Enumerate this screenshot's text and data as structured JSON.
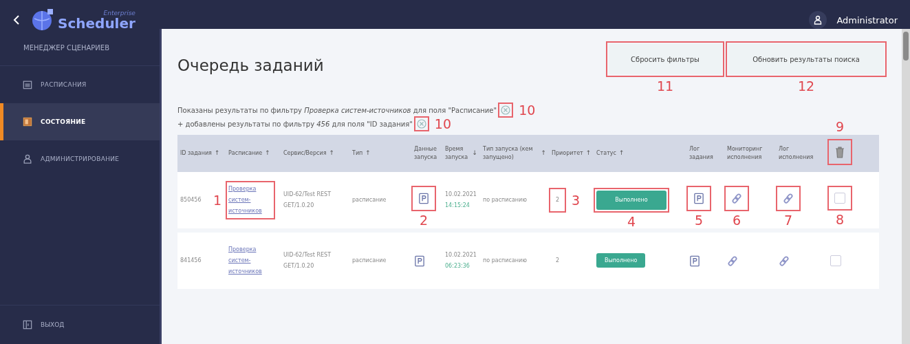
{
  "header": {
    "brand_small": "Enterprise",
    "brand": "Scheduler",
    "user": "Administrator"
  },
  "sidebar": {
    "title": "МЕНЕДЖЕР СЦЕНАРИЕВ",
    "items": [
      {
        "label": "РАСПИСАНИЯ",
        "kind": "calendar",
        "selected": false
      },
      {
        "label": "СОСТОЯНИЕ",
        "kind": "status",
        "selected": true
      },
      {
        "label": "АДМИНИСТРИРОВАНИЕ",
        "kind": "person",
        "selected": false
      }
    ],
    "footer": {
      "label": "ВЫХОД"
    }
  },
  "page": {
    "title": "Очередь заданий",
    "buttons": [
      {
        "label": "Сбросить фильтры",
        "callout": "11"
      },
      {
        "label": "Обновить результаты поиска",
        "callout": "12"
      }
    ]
  },
  "filters": [
    {
      "text": "Показаны результаты по фильтру *Проверка систем-источников* для поля \"Расписание\"",
      "callout": "10"
    },
    {
      "text": "+ добавлены результаты по фильтру *456* для поля \"ID задания\"",
      "callout": "10"
    }
  ],
  "table": {
    "columns": [
      {
        "label": "ID задания",
        "sort": "↑"
      },
      {
        "label": "Расписание",
        "sort": "↑"
      },
      {
        "label": "Сервис/Версия",
        "sort": "↑"
      },
      {
        "label": "Тип",
        "sort": "↑"
      },
      {
        "label": "Данные запуска"
      },
      {
        "label": "Время запуска",
        "sort": "↓"
      },
      {
        "label": "Тип запуска (кем запущено)",
        "sort": "↑"
      },
      {
        "label": "Приоритет",
        "sort": "↑"
      },
      {
        "label": "Статус",
        "sort": "↑"
      },
      {
        "label": "Лог задания"
      },
      {
        "label": "Мониторинг исполнения"
      },
      {
        "label": "Лог исполнения"
      }
    ],
    "delete_callout": "9",
    "rows": [
      {
        "id": "850456",
        "schedule": "Проверка систем-источников",
        "service": "UID-62/Test REST GET/1.0.20",
        "type": "расписание",
        "date": "10.02.2021",
        "time": "14:15:24",
        "launch": "по расписанию",
        "priority": "2",
        "status": "Выполнено",
        "checked": false,
        "callouts": {
          "schedule": "1",
          "data": "2",
          "priority": "3",
          "status": "4",
          "log": "5",
          "monitor": "6",
          "exec": "7",
          "check": "8"
        }
      },
      {
        "id": "841456",
        "schedule": "Проверка систем-источников",
        "service": "UID-62/Test REST GET/1.0.20",
        "type": "расписание",
        "date": "10.02.2021",
        "time": "06:23:36",
        "launch": "по расписанию",
        "priority": "2",
        "status": "Выполнено",
        "checked": false,
        "callouts": {}
      }
    ]
  }
}
